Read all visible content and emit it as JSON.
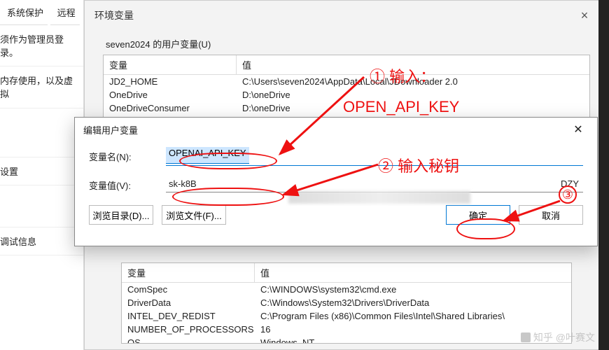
{
  "left": {
    "tab1": "系统保护",
    "tab2": "远程",
    "row1": "须作为管理员登录。",
    "row2": "内存使用，以及虚拟",
    "row3": "",
    "row4": "设置",
    "row5": "调试信息"
  },
  "env": {
    "title": "环境变量",
    "user_section": "seven2024 的用户变量(U)",
    "hdr_var": "变量",
    "hdr_val": "值",
    "user_rows": [
      {
        "var": "JD2_HOME",
        "val": "C:\\Users\\seven2024\\AppData\\Local\\JDownloader 2.0"
      },
      {
        "var": "OneDrive",
        "val": "D:\\oneDrive"
      },
      {
        "var": "OneDriveConsumer",
        "val": "D:\\oneDrive"
      }
    ],
    "sys_rows": [
      {
        "var": "ComSpec",
        "val": "C:\\WINDOWS\\system32\\cmd.exe"
      },
      {
        "var": "DriverData",
        "val": "C:\\Windows\\System32\\Drivers\\DriverData"
      },
      {
        "var": "INTEL_DEV_REDIST",
        "val": "C:\\Program Files (x86)\\Common Files\\Intel\\Shared Libraries\\"
      },
      {
        "var": "NUMBER_OF_PROCESSORS",
        "val": "16"
      },
      {
        "var": "OS",
        "val": "Windows_NT"
      }
    ]
  },
  "edit": {
    "title": "编辑用户变量",
    "name_label": "变量名(N):",
    "name_value": "OPENAI_API_KEY",
    "value_label": "变量值(V):",
    "value_prefix": "sk-k8B",
    "value_suffix": "DZY",
    "browse_dir": "浏览目录(D)...",
    "browse_file": "浏览文件(F)...",
    "ok": "确定",
    "cancel": "取消"
  },
  "anno": {
    "a1": "① 输入：",
    "a1b": "OPEN_API_KEY",
    "a2": "② 输入秘钥",
    "a3": "③"
  },
  "wm": "知乎 @叶赛文"
}
